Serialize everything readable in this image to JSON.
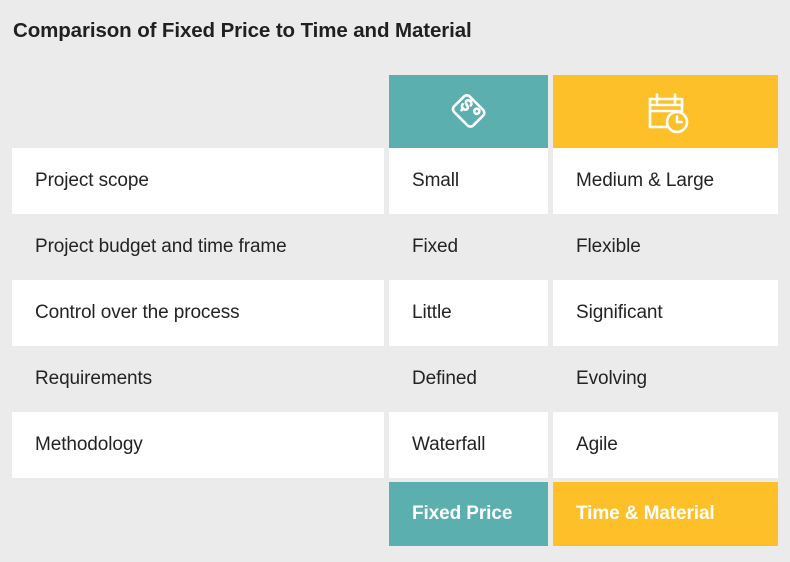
{
  "title": "Comparison of Fixed Price to Time and Material",
  "colors": {
    "background": "#ebebeb",
    "row_white": "#ffffff",
    "fixed_price_accent": "#5bafaf",
    "time_material_accent": "#fdc029",
    "text": "#232323",
    "title_text": "#1f2022",
    "header_icon": "#ffffff"
  },
  "header": {
    "fixed_price_icon": "price-tag-dollar-icon",
    "time_material_icon": "calendar-clock-icon"
  },
  "columns": [
    {
      "key": "criterion",
      "label": ""
    },
    {
      "key": "fixed_price",
      "label": "Fixed Price"
    },
    {
      "key": "time_material",
      "label": "Time & Material"
    }
  ],
  "rows": [
    {
      "criterion": "Project scope",
      "fixed_price": "Small",
      "time_material": "Medium & Large"
    },
    {
      "criterion": "Project budget and time frame",
      "fixed_price": "Fixed",
      "time_material": "Flexible"
    },
    {
      "criterion": "Control over the process",
      "fixed_price": "Little",
      "time_material": "Significant"
    },
    {
      "criterion": "Requirements",
      "fixed_price": "Defined",
      "time_material": "Evolving"
    },
    {
      "criterion": "Methodology",
      "fixed_price": "Waterfall",
      "time_material": "Agile"
    }
  ],
  "footer": {
    "fixed_price_label": "Fixed Price",
    "time_material_label": "Time & Material"
  }
}
